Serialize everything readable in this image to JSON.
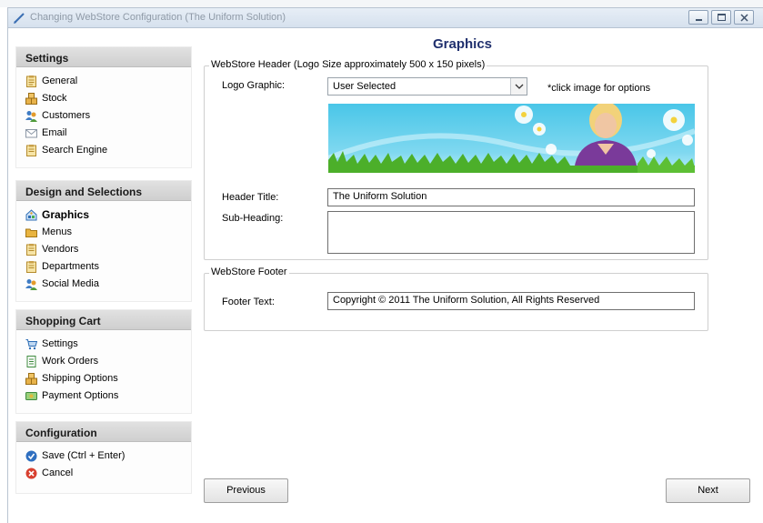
{
  "window": {
    "title": "Changing WebStore Configuration  (The Uniform Solution)"
  },
  "sidebar": {
    "sections": [
      {
        "header": "Settings",
        "items": [
          {
            "label": "General",
            "icon": "clipboard-icon"
          },
          {
            "label": "Stock",
            "icon": "boxes-icon"
          },
          {
            "label": "Customers",
            "icon": "users-icon"
          },
          {
            "label": "Email",
            "icon": "envelope-icon"
          },
          {
            "label": "Search Engine",
            "icon": "clipboard-icon"
          }
        ]
      },
      {
        "header": "Design and Selections",
        "items": [
          {
            "label": "Graphics",
            "icon": "graphics-icon",
            "active": true
          },
          {
            "label": "Menus",
            "icon": "folder-icon"
          },
          {
            "label": "Vendors",
            "icon": "clipboard-icon"
          },
          {
            "label": "Departments",
            "icon": "clipboard-icon"
          },
          {
            "label": "Social Media",
            "icon": "users-icon"
          }
        ]
      },
      {
        "header": "Shopping Cart",
        "items": [
          {
            "label": "Settings",
            "icon": "cart-icon"
          },
          {
            "label": "Work Orders",
            "icon": "document-icon"
          },
          {
            "label": "Shipping Options",
            "icon": "boxes-icon"
          },
          {
            "label": "Payment Options",
            "icon": "payment-icon"
          }
        ]
      },
      {
        "header": "Configuration",
        "items": [
          {
            "label": "Save (Ctrl + Enter)",
            "icon": "check-circle-icon"
          },
          {
            "label": "Cancel",
            "icon": "cancel-circle-icon"
          }
        ]
      }
    ]
  },
  "main": {
    "title": "Graphics",
    "header_group": {
      "legend": "WebStore Header  (Logo Size approximately 500 x 150 pixels)",
      "logo_label": "Logo Graphic:",
      "logo_value": "User Selected",
      "logo_hint": "*click image for options",
      "title_label": "Header Title:",
      "title_value": "The Uniform Solution",
      "subheading_label": "Sub-Heading:",
      "subheading_value": ""
    },
    "footer_group": {
      "legend": "WebStore Footer",
      "footer_label": "Footer Text:",
      "footer_value": "Copyright © 2011 The Uniform Solution, All Rights Reserved"
    },
    "previous_label": "Previous",
    "next_label": "Next"
  },
  "colors": {
    "title_blue": "#20306e",
    "banner_sky": "#3cc3e6",
    "grass": "#4caf2a"
  }
}
